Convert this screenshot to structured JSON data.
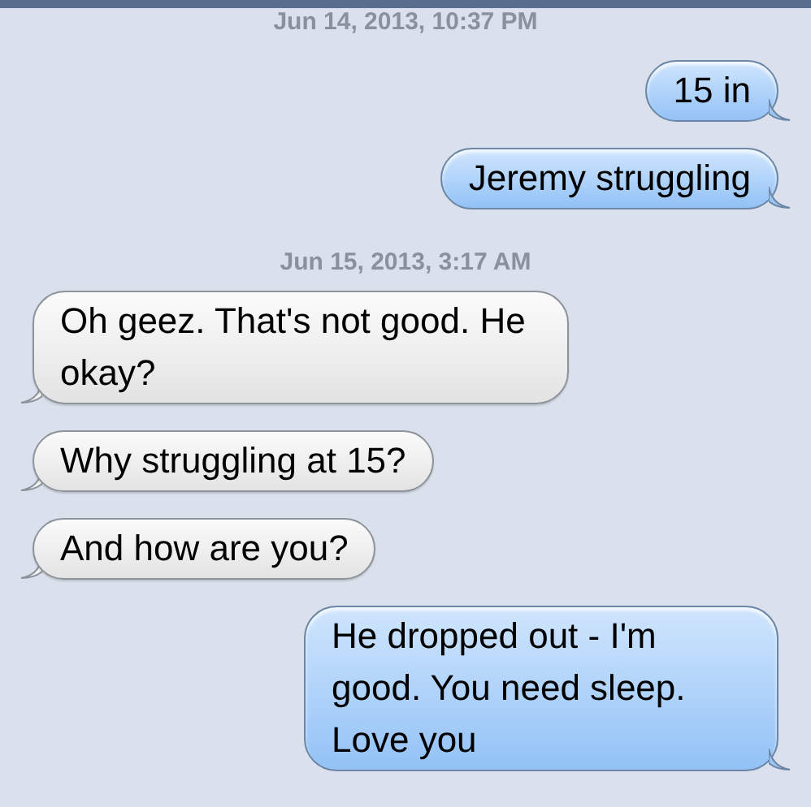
{
  "messages": [
    {
      "kind": "timestamp",
      "text": "Jun 14, 2013, 10:37 PM"
    },
    {
      "kind": "sent",
      "text": "15 in"
    },
    {
      "kind": "sent",
      "text": "Jeremy struggling"
    },
    {
      "kind": "timestamp",
      "text": "Jun 15, 2013, 3:17 AM"
    },
    {
      "kind": "received",
      "text": "Oh geez. That's not good. He okay?"
    },
    {
      "kind": "received",
      "text": "Why struggling at 15?"
    },
    {
      "kind": "received",
      "text": "And how are you?"
    },
    {
      "kind": "sent",
      "text": "He dropped out - I'm good. You need sleep. Love you"
    }
  ]
}
